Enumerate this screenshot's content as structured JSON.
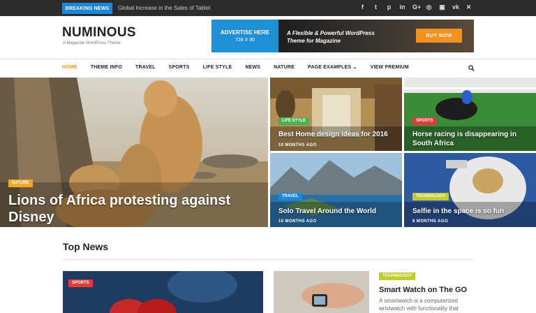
{
  "topbar": {
    "breaking_label": "BREAKING NEWS",
    "ticker_text": "Global Increase in the Sales of Tablet",
    "social_icons": [
      "facebook-icon",
      "twitter-icon",
      "pinterest-icon",
      "linkedin-icon",
      "googleplus-icon",
      "instagram-icon",
      "youtube-icon",
      "vk-icon",
      "xing-icon"
    ],
    "social_glyphs": [
      "f",
      "t",
      "p",
      "in",
      "G+",
      "◎",
      "▣",
      "vk",
      "✕"
    ]
  },
  "header": {
    "logo": "NUMINOUS",
    "tagline": "A Magazine WordPress Theme",
    "ad": {
      "left_line1": "ADVERTISE HERE",
      "left_line2": "728 X 90",
      "mid_line1": "A Flexible & Powerful WordPress",
      "mid_line2": "Theme for Magazine",
      "button": "BUY NOW"
    }
  },
  "nav": {
    "items": [
      "HOME",
      "THEME INFO",
      "TRAVEL",
      "SPORTS",
      "LIFE STYLE",
      "NEWS",
      "NATURE",
      "PAGE EXAMPLES ⌄",
      "VIEW PREMIUM"
    ]
  },
  "featured": {
    "hero": {
      "badge": "NATURE",
      "title": "Lions of Africa protesting against Disney"
    },
    "tiles": [
      {
        "badge": "LIFE STYLE",
        "title": "Best Home design ideas for 2016",
        "date": "10 MONTHS AGO"
      },
      {
        "badge": "SPORTS",
        "title": "Horse racing is disappearing in South Africa",
        "date": ""
      },
      {
        "badge": "TRAVEL",
        "title": "Solo Travel Around the World",
        "date": "10 MONTHS AGO"
      },
      {
        "badge": "TECHNOLOGY",
        "title": "Selfie in the space is so fun",
        "date": "8 MONTHS AGO"
      }
    ]
  },
  "top_news": {
    "title": "Top News",
    "card1_badge": "SPORTS",
    "card2_badge": "TECHNOLOGY",
    "card2_title": "Smart Watch on The GO",
    "card2_excerpt": "A smartwatch is a computerized wristwatch with functionality that"
  },
  "colors": {
    "accent": "#f5921e",
    "blue": "#1e88d8",
    "nature": "#f5a623",
    "lifestyle": "#4caf50",
    "sports": "#e53935",
    "travel": "#1e88d8",
    "technology": "#c0ca33"
  }
}
